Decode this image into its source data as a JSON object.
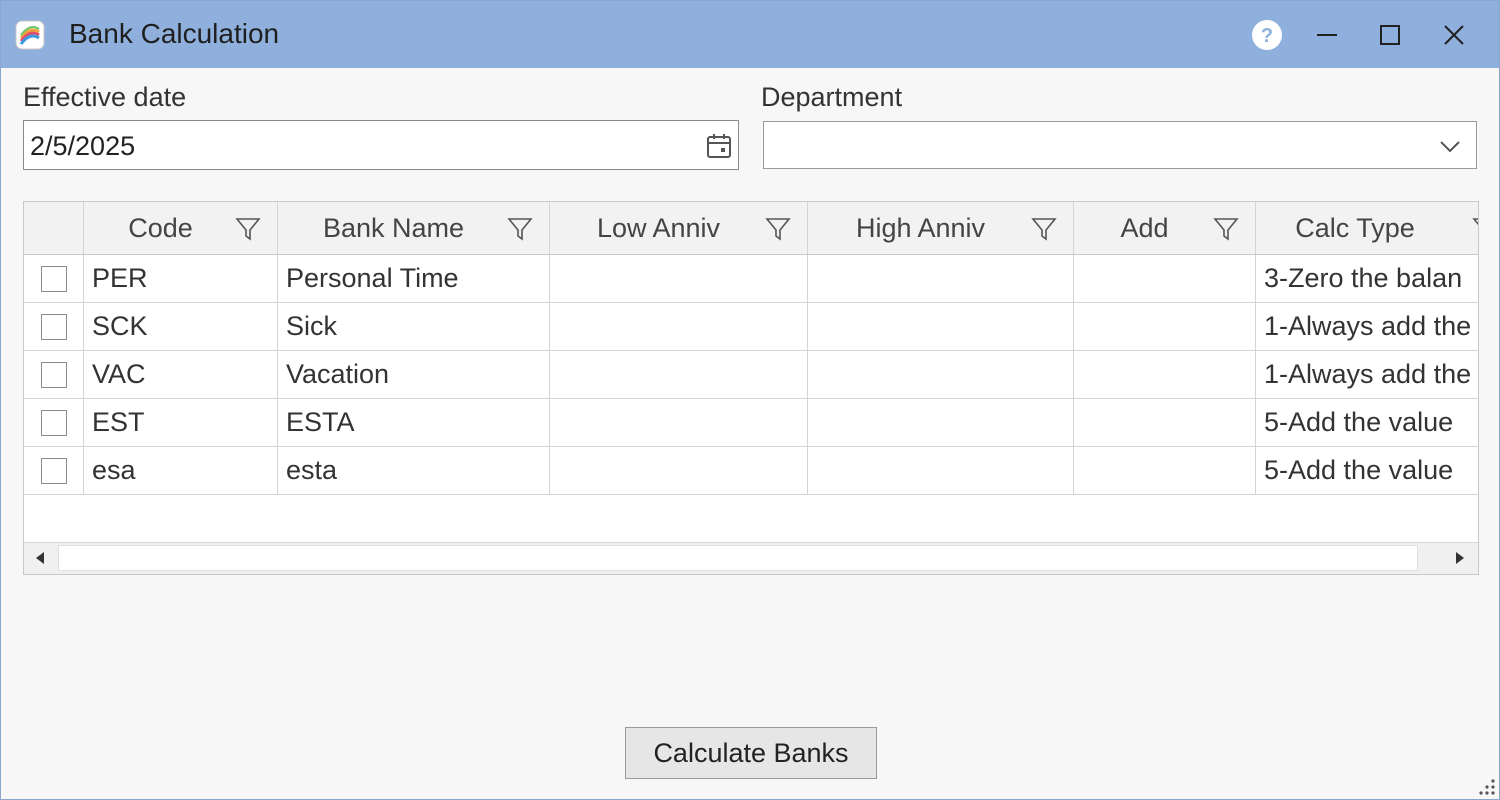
{
  "window": {
    "title": "Bank Calculation",
    "title_bar_color": "#8fb0dd"
  },
  "titlebar_buttons": {
    "help_icon": "question-circle-icon",
    "minimize_icon": "minimize-icon",
    "maximize_icon": "maximize-icon",
    "close_icon": "close-icon"
  },
  "form": {
    "effective_date_label": "Effective date",
    "effective_date_value": "2/5/2025",
    "department_label": "Department",
    "department_value": ""
  },
  "grid": {
    "columns": [
      "",
      "Code",
      "Bank Name",
      "Low Anniv",
      "High Anniv",
      "Add",
      "Calc Type"
    ],
    "rows": [
      {
        "checked": false,
        "code": "PER",
        "bank_name": "Personal Time",
        "low_anniv": "",
        "high_anniv": "",
        "add": "",
        "calc_type": "3-Zero the balan"
      },
      {
        "checked": false,
        "code": "SCK",
        "bank_name": "Sick",
        "low_anniv": "",
        "high_anniv": "",
        "add": "",
        "calc_type": "1-Always add the"
      },
      {
        "checked": false,
        "code": "VAC",
        "bank_name": "Vacation",
        "low_anniv": "",
        "high_anniv": "",
        "add": "",
        "calc_type": "1-Always add the"
      },
      {
        "checked": false,
        "code": "EST",
        "bank_name": "ESTA",
        "low_anniv": "",
        "high_anniv": "",
        "add": "",
        "calc_type": "5-Add the value"
      },
      {
        "checked": false,
        "code": "esa",
        "bank_name": "esta",
        "low_anniv": "",
        "high_anniv": "",
        "add": "",
        "calc_type": "5-Add the value"
      }
    ]
  },
  "actions": {
    "calculate_label": "Calculate Banks"
  }
}
